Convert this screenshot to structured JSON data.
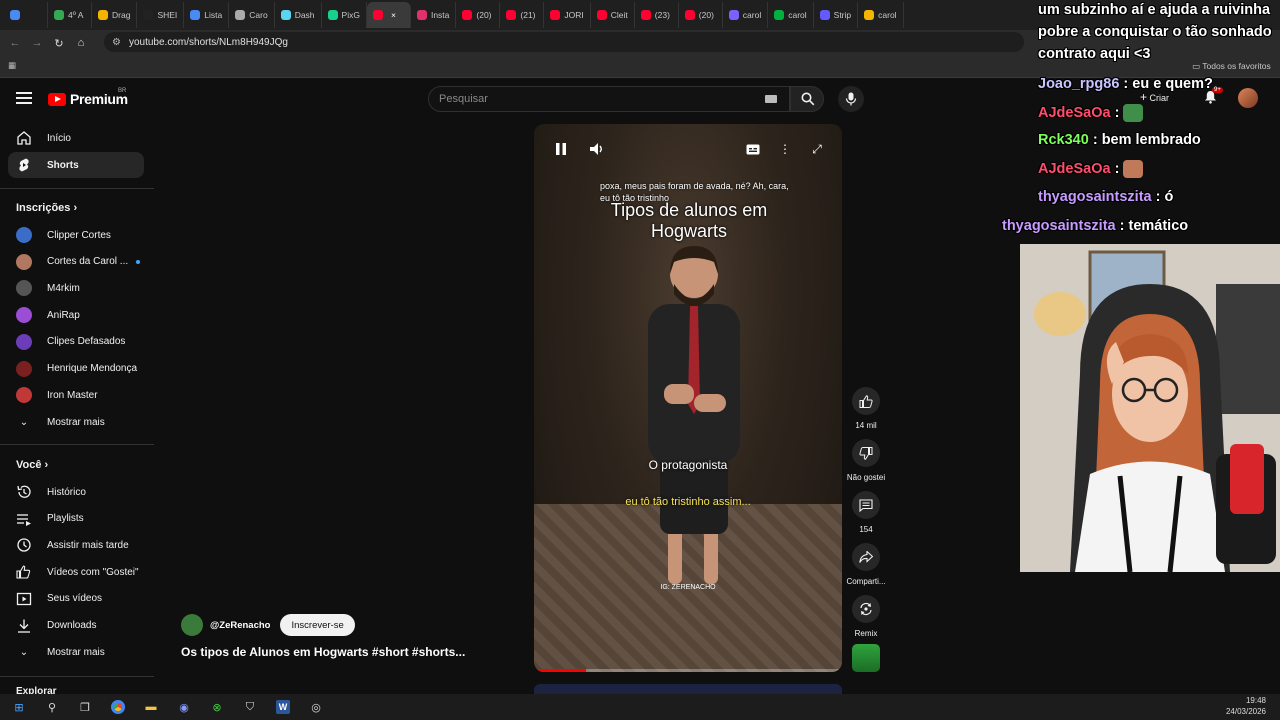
{
  "browser": {
    "tabs": [
      {
        "label": "",
        "color": "#4a8af4"
      },
      {
        "label": "4º A",
        "color": "#34a853"
      },
      {
        "label": "Drag",
        "color": "#f4b400"
      },
      {
        "label": "SHEI",
        "color": "#222222"
      },
      {
        "label": "Lista",
        "color": "#4a8af4"
      },
      {
        "label": "Caro",
        "color": "#aaaaaa"
      },
      {
        "label": "Dash",
        "color": "#5ad6f0"
      },
      {
        "label": "PixG",
        "color": "#18d18c"
      },
      {
        "label": "",
        "color": "#ff0033",
        "active": true
      },
      {
        "label": "Insta",
        "color": "#e1306c"
      },
      {
        "label": "(20)",
        "color": "#ff0033"
      },
      {
        "label": "(21)",
        "color": "#ff0033"
      },
      {
        "label": "JORI",
        "color": "#ff0033"
      },
      {
        "label": "Cleit",
        "color": "#ff0033"
      },
      {
        "label": "(23)",
        "color": "#ff0033"
      },
      {
        "label": "(20)",
        "color": "#ff0033"
      },
      {
        "label": "carol",
        "color": "#7b61ff"
      },
      {
        "label": "carol",
        "color": "#00b140"
      },
      {
        "label": "Strip",
        "color": "#635bff"
      },
      {
        "label": "carol",
        "color": "#f4b400"
      }
    ],
    "url": "youtube.com/shorts/NLm8H949JQg",
    "bookmarks_label": "Todos os favoritos"
  },
  "youtube": {
    "logo_text": "Premium",
    "country": "BR",
    "search_placeholder": "Pesquisar",
    "create_label": "Criar",
    "notif_count": "9+"
  },
  "sidebar": {
    "main": [
      {
        "label": "Início",
        "icon": "home-icon"
      },
      {
        "label": "Shorts",
        "icon": "shorts-icon",
        "active": true
      }
    ],
    "subs_header": "Inscrições",
    "subs": [
      {
        "label": "Clipper Cortes",
        "color": "#3a6cc8"
      },
      {
        "label": "Cortes da Carol ...",
        "color": "#b07860",
        "live": true
      },
      {
        "label": "M4rkim",
        "color": "#555555"
      },
      {
        "label": "AniRap",
        "color": "#9b4dd6"
      },
      {
        "label": "Clipes Defasados",
        "color": "#6b3db8"
      },
      {
        "label": "Henrique Mendonça",
        "color": "#7a2020"
      },
      {
        "label": "Iron Master",
        "color": "#c03838"
      }
    ],
    "subs_more": "Mostrar mais",
    "you_header": "Você",
    "you": [
      {
        "label": "Histórico",
        "icon": "history-icon"
      },
      {
        "label": "Playlists",
        "icon": "playlists-icon"
      },
      {
        "label": "Assistir mais tarde",
        "icon": "watch-later-icon"
      },
      {
        "label": "Vídeos com \"Gostei\"",
        "icon": "liked-icon"
      },
      {
        "label": "Seus vídeos",
        "icon": "your-videos-icon"
      },
      {
        "label": "Downloads",
        "icon": "download-icon"
      }
    ],
    "you_more": "Mostrar mais",
    "explore_header": "Explorar"
  },
  "video": {
    "top_caption": "poxa, meus pais foram de avada, né? Ah, cara, eu tô tão tristinho",
    "title_overlay": "Tipos de alunos em Hogwarts",
    "caption_main": "O protagonista",
    "caption_yellow": "eu tô tão tristinho assim...",
    "watermark": "IG: ZERENACHO",
    "progress": 0.17
  },
  "actions": {
    "likes": "14 mil",
    "dislike": "Não gostei",
    "comments": "154",
    "share": "Comparti...",
    "remix": "Remix"
  },
  "channel": {
    "name": "@ZeRenacho",
    "subscribe": "Inscrever-se",
    "title": "Os tipos de Alunos em Hogwarts #short #shorts..."
  },
  "chat": [
    {
      "user": "",
      "msg": "um subzinho aí e ajuda a ruivinha",
      "color": "#ffffff"
    },
    {
      "user": "",
      "msg": "pobre a conquistar o tão sonhado",
      "color": "#ffffff"
    },
    {
      "user": "",
      "msg": "contrato aqui <3",
      "color": "#ffffff"
    },
    {
      "user": "Joao_rpg86",
      "msg": "eu e quem?",
      "color": "#c9c4ff"
    },
    {
      "user": "AJdeSaOa",
      "msg": "",
      "color": "#ff4d6d",
      "emote": "#3f8f4a"
    },
    {
      "user": "Rck340",
      "msg": "bem lembrado",
      "color": "#7cff5a"
    },
    {
      "user": "AJdeSaOa",
      "msg": "",
      "color": "#ff4d6d",
      "emote": "#c07a5a"
    },
    {
      "user": "thyagosaintszita",
      "msg": "ó",
      "color": "#c79bff"
    },
    {
      "user": "thyagosaintszita",
      "msg": "temático",
      "color": "#c79bff"
    }
  ],
  "taskbar": {
    "time": "19:48",
    "date": "24/03/2026"
  }
}
